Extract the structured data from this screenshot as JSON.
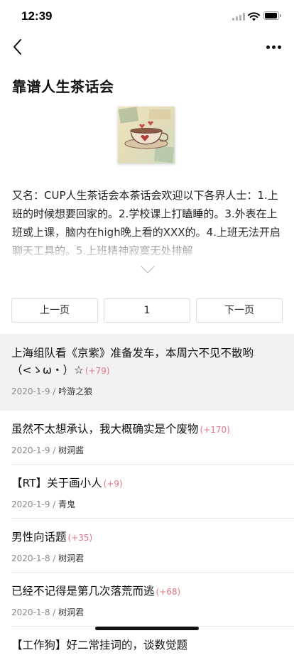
{
  "status_bar": {
    "time": "12:39"
  },
  "nav": {
    "back_icon": "chevron-left-icon",
    "more_icon": "more-horizontal-icon"
  },
  "group": {
    "title": "靠谱人生茶话会",
    "cover_icon": "teacup-cover-image",
    "description": "又名：CUP人生茶话会本茶话会欢迎以下各界人士：1.上班的时候想要回家的。2.学校课上打瞌睡的。3.外表在上班或上课，脑内在high晚上看的XXX的。4.上班无法开启聊天工具的。5.上班精神寂寞无处排解"
  },
  "pager": {
    "prev_label": "上一页",
    "page": "1",
    "next_label": "下一页"
  },
  "topics": [
    {
      "title": "上海组队看《京紫》准备发车，本周六不见不散哟（<ゝω・）☆",
      "count": "(+79)",
      "date": "2020-1-9",
      "author": "吟游之狼",
      "highlight": true
    },
    {
      "title": "虽然不太想承认，我大概确实是个废物",
      "count": "(+170)",
      "date": "2020-1-9",
      "author": "树洞酱",
      "highlight": false
    },
    {
      "title": "【RT】关于画小人",
      "count": "(+9)",
      "date": "2020-1-9",
      "author": "青鬼",
      "highlight": false
    },
    {
      "title": "男性向话题",
      "count": "(+35)",
      "date": "2020-1-8",
      "author": "树洞君",
      "highlight": false
    },
    {
      "title": "已经不记得是第几次落荒而逃",
      "count": "(+68)",
      "date": "2020-1-8",
      "author": "树洞君",
      "highlight": false
    },
    {
      "title": "【工作狗】好二常挂词的，谈数觉题",
      "count": "",
      "date": "",
      "author": "",
      "highlight": false
    }
  ],
  "colors": {
    "count": "#e57585",
    "meta": "#888888",
    "highlight_bg": "#f2f2f2",
    "divider": "#e8e8e8"
  }
}
